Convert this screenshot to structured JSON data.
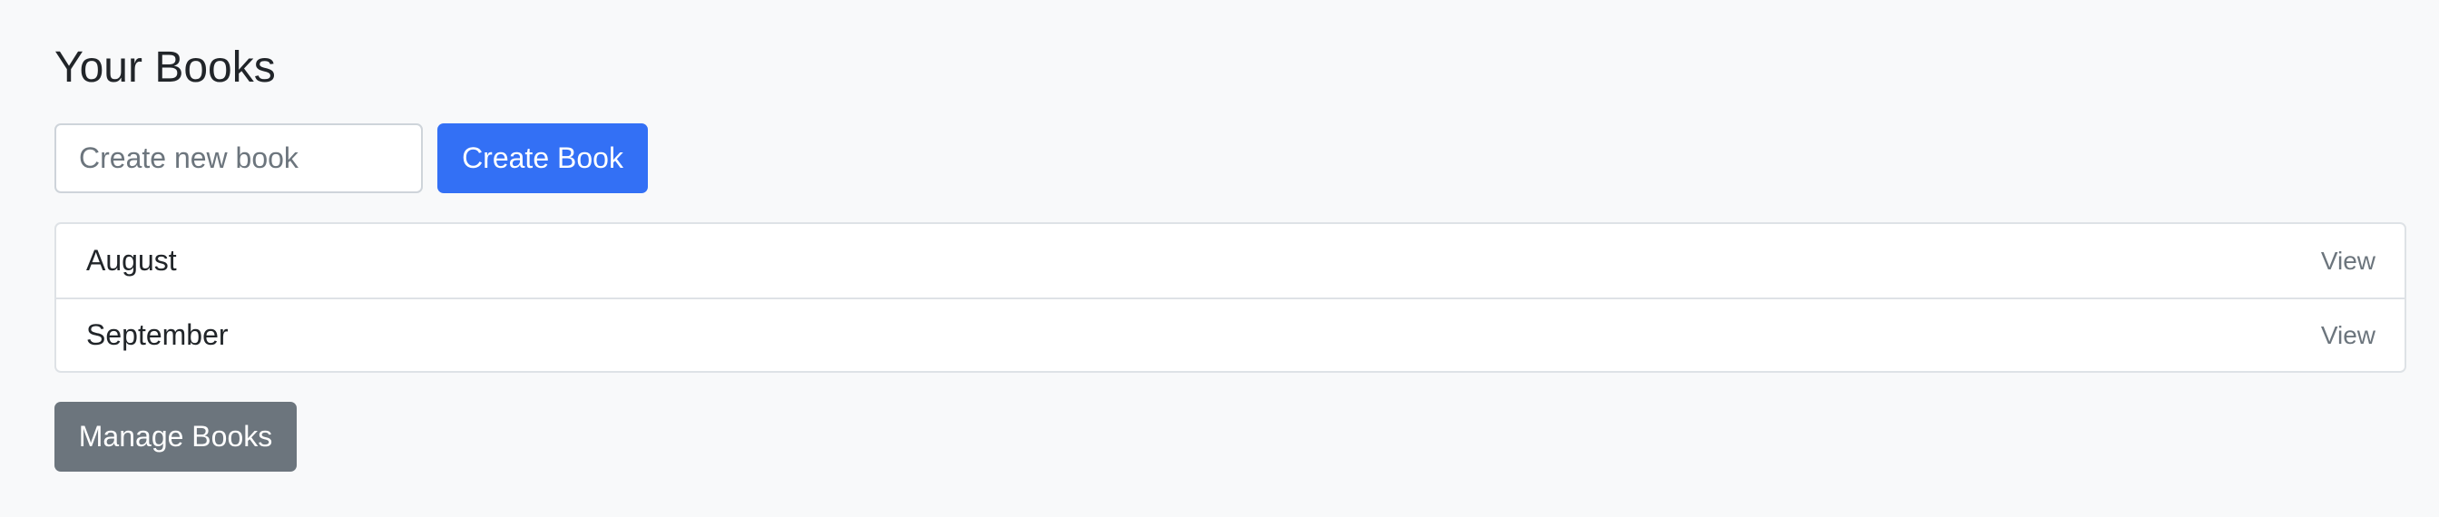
{
  "page": {
    "title": "Your Books"
  },
  "create": {
    "placeholder": "Create new book",
    "value": "",
    "button_label": "Create Book"
  },
  "books": [
    {
      "name": "August",
      "action_label": "View"
    },
    {
      "name": "September",
      "action_label": "View"
    }
  ],
  "manage": {
    "button_label": "Manage Books"
  },
  "colors": {
    "background": "#f8f9fa",
    "primary": "#3370f5",
    "secondary": "#6c757d",
    "border": "#dee2e6",
    "text": "#212529",
    "muted": "#6c757d"
  }
}
